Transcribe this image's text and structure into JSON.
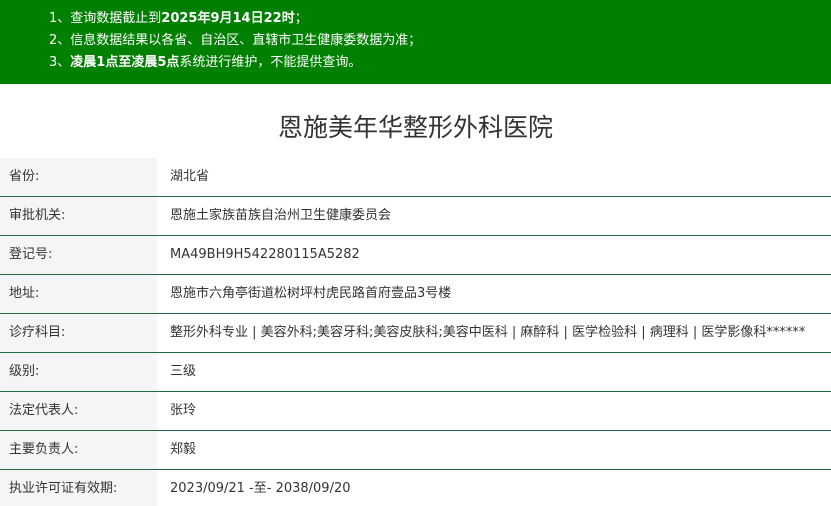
{
  "notice": {
    "line1_prefix": "1、查询数据截止到",
    "line1_bold": "2025年9月14日22时",
    "line1_suffix": "；",
    "line2": "2、信息数据结果以各省、自治区、直辖市卫生健康委数据为准；",
    "line3_prefix": "3、",
    "line3_bold": "凌晨1点至凌晨5点",
    "line3_suffix": "系统进行维护，不能提供查询。",
    "background_color": "#008000"
  },
  "hospital": {
    "name": "恩施美年华整形外科医院"
  },
  "details": [
    {
      "label": "省份:",
      "value": "湖北省"
    },
    {
      "label": "审批机关:",
      "value": "恩施土家族苗族自治州卫生健康委员会"
    },
    {
      "label": "登记号:",
      "value": "MA49BH9H542280115A5282"
    },
    {
      "label": "地址:",
      "value": "恩施市六角亭街道松树坪村虎民路首府壹品3号楼"
    },
    {
      "label": "诊疗科目:",
      "value": "整形外科专业 | 美容外科;美容牙科;美容皮肤科;美容中医科 | 麻醉科 | 医学检验科 | 病理科 | 医学影像科******"
    },
    {
      "label": "级别:",
      "value": "三级"
    },
    {
      "label": "法定代表人:",
      "value": "张玲"
    },
    {
      "label": "主要负责人:",
      "value": "郑毅"
    },
    {
      "label": "执业许可证有效期:",
      "value": "2023/09/21 -至- 2038/09/20"
    }
  ]
}
